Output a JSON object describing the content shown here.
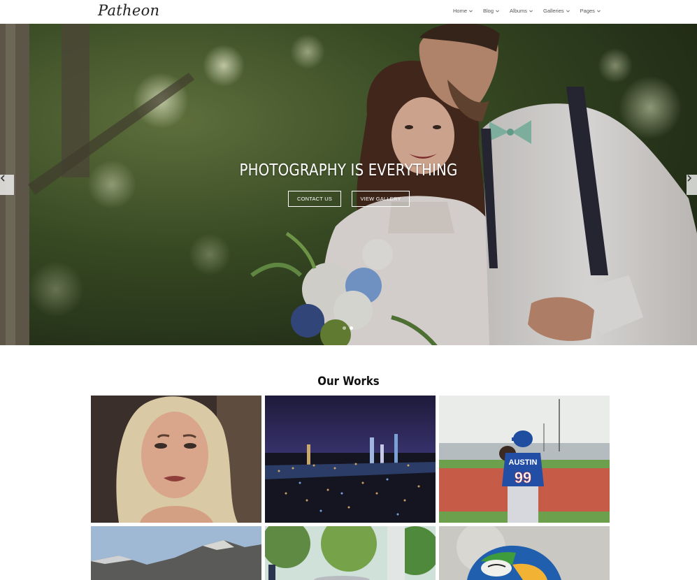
{
  "header": {
    "logo": "Patheon",
    "nav": [
      {
        "label": "Home"
      },
      {
        "label": "Blog"
      },
      {
        "label": "Albums"
      },
      {
        "label": "Galleries"
      },
      {
        "label": "Pages"
      }
    ]
  },
  "hero": {
    "title": "PHOTOGRAPHY IS EVERYTHING",
    "buttons": {
      "contact": "CONTACT US",
      "gallery": "VIEW GALLERY"
    },
    "jersey_name": "AUSTIN",
    "jersey_number": "99"
  },
  "works": {
    "title": "Our Works"
  }
}
